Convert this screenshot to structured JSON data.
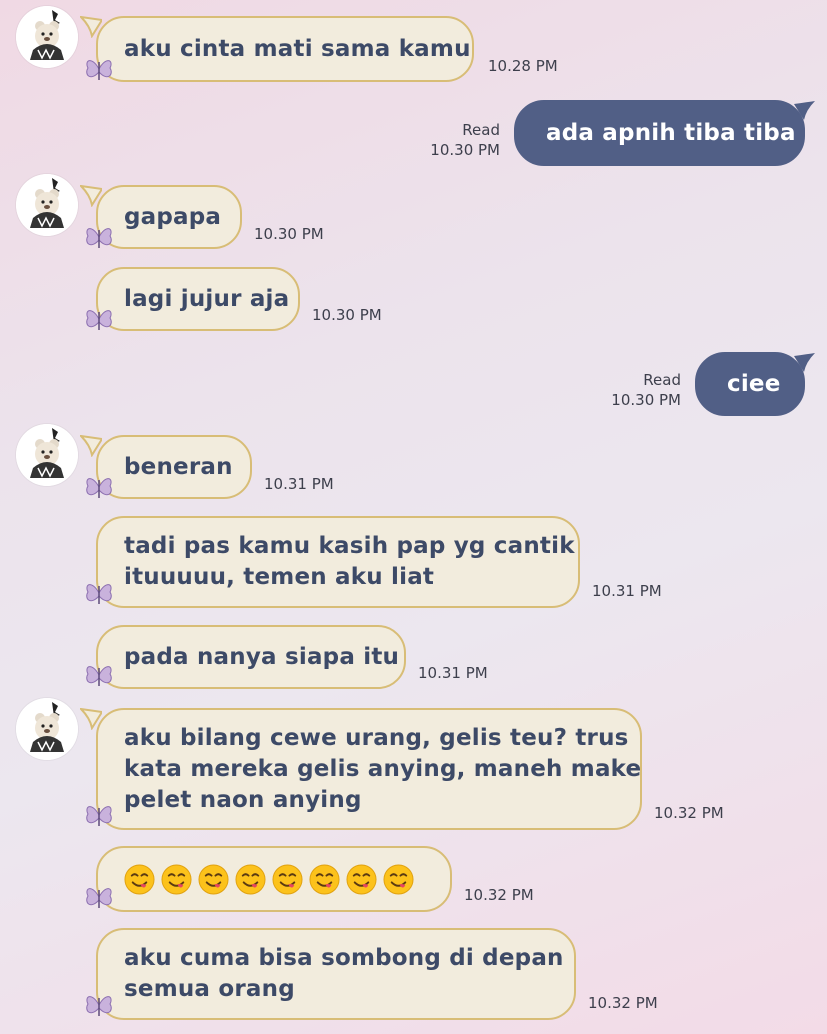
{
  "messages": [
    {
      "side": "in",
      "lines": [
        "aku cinta mati sama kamu"
      ],
      "time": "10.28 PM"
    },
    {
      "side": "out",
      "lines": [
        "ada apnih tiba tiba"
      ],
      "read": "Read",
      "time": "10.30 PM"
    },
    {
      "side": "in",
      "lines": [
        "gapapa"
      ],
      "time": "10.30 PM"
    },
    {
      "side": "in",
      "lines": [
        "lagi jujur aja"
      ],
      "time": "10.30 PM"
    },
    {
      "side": "out",
      "lines": [
        "ciee"
      ],
      "read": "Read",
      "time": "10.30 PM"
    },
    {
      "side": "in",
      "lines": [
        "beneran"
      ],
      "time": "10.31 PM"
    },
    {
      "side": "in",
      "lines": [
        "tadi pas kamu kasih pap yg cantik",
        "ituuuuu, temen aku liat"
      ],
      "time": "10.31 PM"
    },
    {
      "side": "in",
      "lines": [
        "pada nanya siapa itu"
      ],
      "time": "10.31 PM"
    },
    {
      "side": "in",
      "lines": [
        "aku bilang cewe urang, gelis teu? trus",
        "kata mereka gelis anying, maneh make",
        "pelet naon anying"
      ],
      "time": "10.32 PM"
    },
    {
      "side": "in",
      "emoji": "face-savoring-food",
      "emoji_count": 8,
      "time": "10.32 PM"
    },
    {
      "side": "in",
      "lines": [
        "aku cuma bisa sombong di depan",
        "semua orang"
      ],
      "time": "10.32 PM"
    }
  ],
  "icons": {
    "avatar": "avatar-teddy-bear",
    "bubble_decoration": "butterfly-icon"
  },
  "colors": {
    "incoming_bubble": "#f2ecdd",
    "incoming_border": "#d8bd76",
    "incoming_text": "#3d4a67",
    "outgoing_bubble": "#515f86",
    "outgoing_text": "#ffffff"
  }
}
